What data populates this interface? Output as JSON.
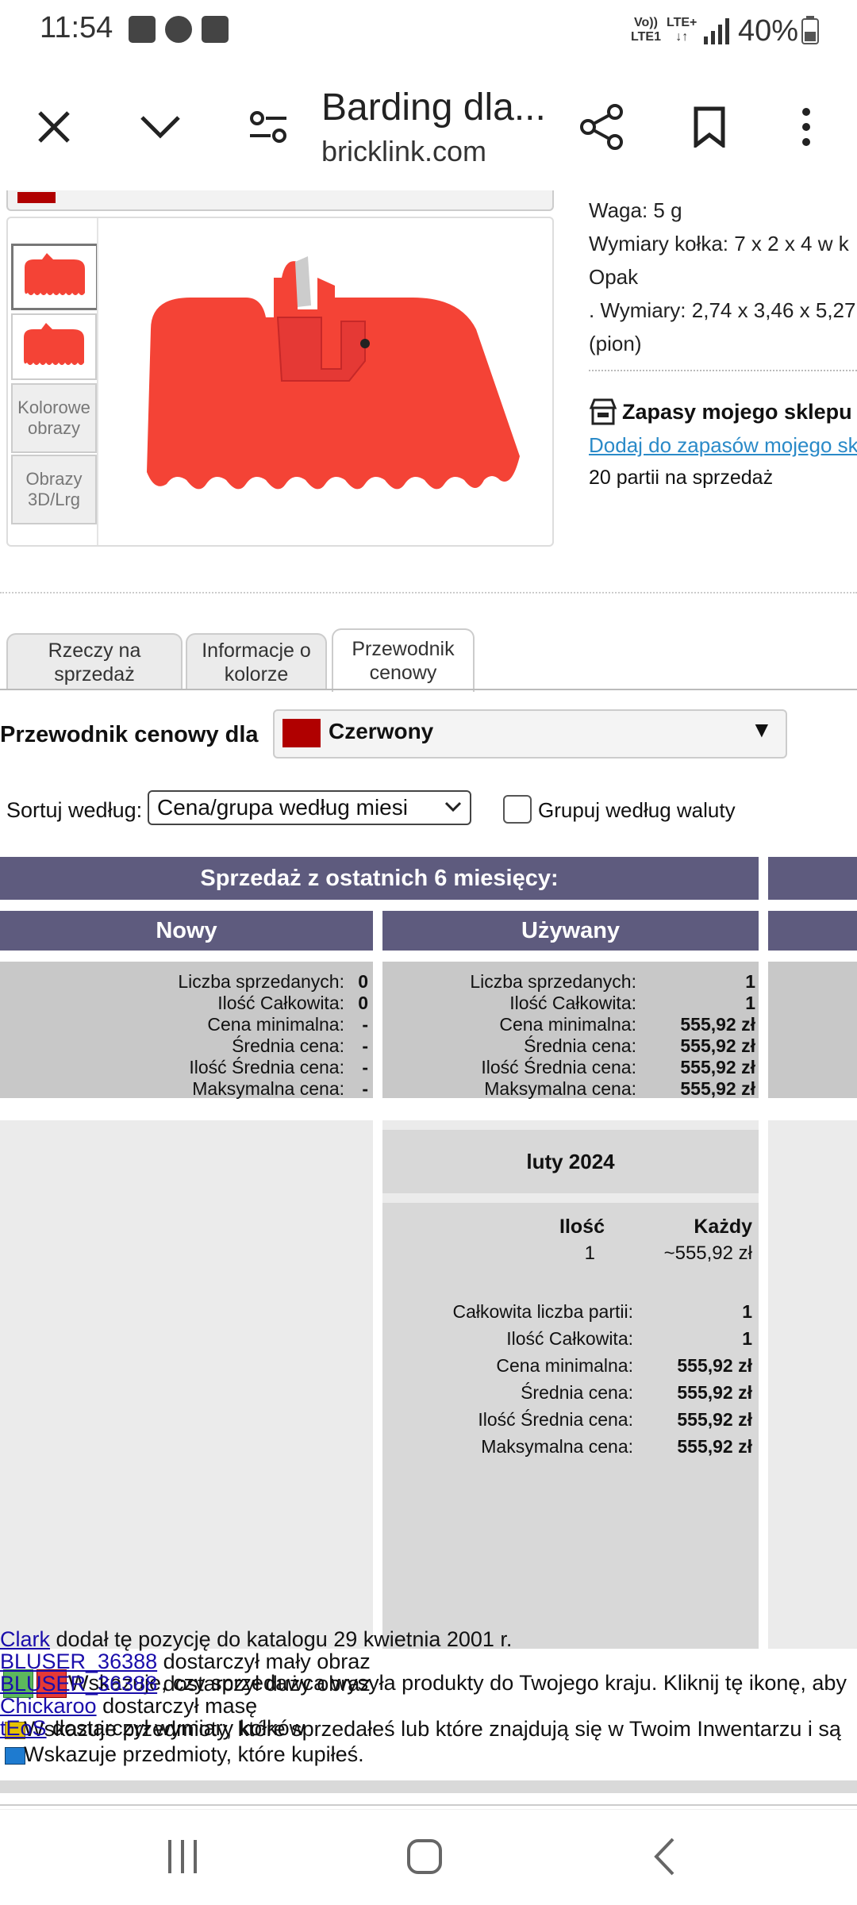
{
  "status_bar": {
    "time": "11:54",
    "network_line1": "Vo))",
    "network_line2": "LTE1",
    "lte_line1": "LTE+",
    "lte_line2": "↓↑",
    "battery": "40%"
  },
  "toolbar": {
    "title": "Barding dla...",
    "domain": "bricklink.com"
  },
  "thumbnails": {
    "color_images": "Kolorowe obrazy",
    "images_3d": "Obrazy 3D/Lrg"
  },
  "specs": {
    "weight": "Waga: 5 g",
    "stud_dims": "Wymiary kołka: 7 x 2 x 4 w k",
    "pack": "Opak",
    "dims": ". Wymiary: 2,74 x 3,46 x 5,27",
    "orientation": "(pion)"
  },
  "store": {
    "title": "Zapasy mojego sklepu",
    "add_link": "Dodaj do zapasów mojego skle",
    "lots": "20 partii na sprzedaż"
  },
  "tabs": [
    {
      "label_line1": "Rzeczy na",
      "label_line2": "sprzedaż"
    },
    {
      "label_line1": "Informacje o",
      "label_line2": "kolorze"
    },
    {
      "label_line1": "Przewodnik",
      "label_line2": "cenowy"
    }
  ],
  "price_guide": {
    "label": "Przewodnik cenowy dla",
    "color_name": "Czerwony",
    "color_hex": "#b00000",
    "sort_label": "Sortuj według:",
    "sort_value": "Cena/grupa według miesi",
    "group_currency_label": "Grupuj według waluty"
  },
  "sales": {
    "header": "Sprzedaż z ostatnich 6 miesięcy:",
    "new_header": "Nowy",
    "used_header": "Używany",
    "labels": [
      "Liczba sprzedanych:",
      "Ilość Całkowita:",
      "Cena minimalna:",
      "Średnia cena:",
      "Ilość Średnia cena:",
      "Maksymalna cena:"
    ],
    "new_values": [
      "0",
      "0",
      "-",
      "-",
      "-",
      "-"
    ],
    "used_values": [
      "1",
      "1",
      "555,92 zł",
      "555,92 zł",
      "555,92 zł",
      "555,92 zł"
    ]
  },
  "monthly": {
    "month": "luty 2024",
    "qty_header": "Ilość",
    "each_header": "Każdy",
    "qty": "1",
    "each": "~555,92 zł",
    "labels": [
      "Całkowita liczba partii:",
      "Ilość Całkowita:",
      "Cena minimalna:",
      "Średnia cena:",
      "Ilość Średnia cena:",
      "Maksymalna cena:"
    ],
    "values": [
      "1",
      "1",
      "555,92 zł",
      "555,92 zł",
      "555,92 zł",
      "555,92 zł"
    ]
  },
  "legend": {
    "ships_note": "Wskazuje, czy sprzedawca wysyła produkty do Twojego kraju. Kliknij tę ikonę, aby",
    "inventory_note": "Wskazuje przedmioty, które sprzedałeś lub które znajdują się w Twoim Inwentarzu i są",
    "bought_note": "Wskazuje przedmioty, które kupiłeś."
  },
  "credits": [
    {
      "user": "Clark",
      "text": " dodał tę pozycję do katalogu 29 kwietnia 2001 r."
    },
    {
      "user": "BLUSER_36388",
      "text": " dostarczył mały obraz"
    },
    {
      "user": "BLUSER_36388",
      "text": " dostarczył duży obraz"
    },
    {
      "user": "Chickaroo",
      "text": " dostarczył masę"
    },
    {
      "user": "tEoS",
      "text": " dostarczył wymiary kołków"
    }
  ]
}
